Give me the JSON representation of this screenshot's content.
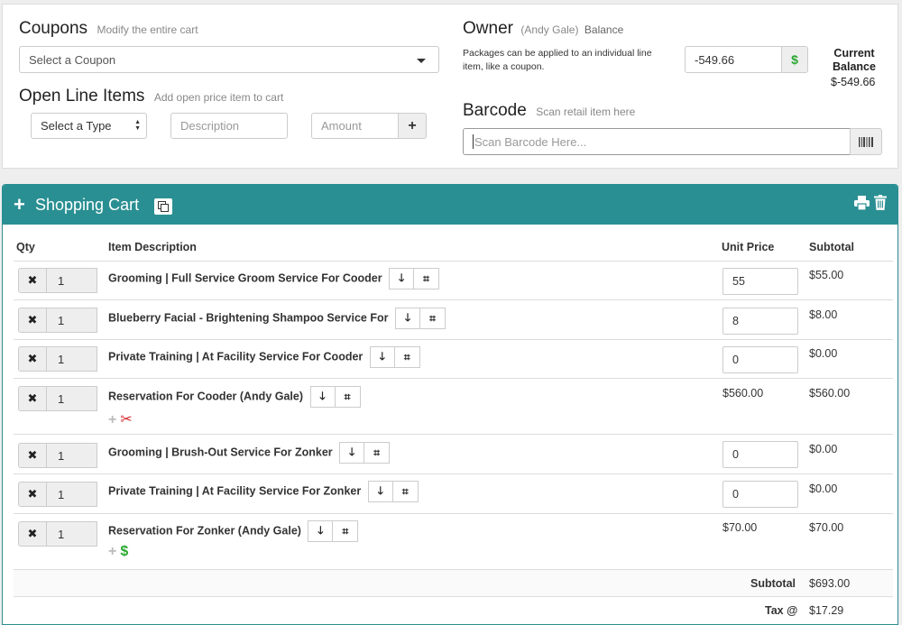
{
  "coupons": {
    "title": "Coupons",
    "subtitle": "Modify the entire cart",
    "select_value": "Select a Coupon"
  },
  "open_items": {
    "title": "Open Line Items",
    "subtitle": "Add open price item to cart",
    "type_value": "Select a Type",
    "description_placeholder": "Description",
    "amount_placeholder": "Amount",
    "add_label": "+"
  },
  "owner": {
    "title": "Owner",
    "owner_name": "(Andy Gale)",
    "balance_label": "Balance",
    "note": "Packages can be applied to an individual line item, like a coupon.",
    "balance_value": "-549.66",
    "dollar_label": "$",
    "current_balance_label": "Current Balance",
    "current_balance_value": "$-549.66"
  },
  "barcode": {
    "title": "Barcode",
    "subtitle": "Scan retail item here",
    "placeholder": "Scan Barcode Here..."
  },
  "cart": {
    "title": "Shopping Cart",
    "columns": {
      "qty": "Qty",
      "description": "Item Description",
      "unit_price": "Unit Price",
      "subtotal": "Subtotal"
    },
    "rows": [
      {
        "qty": "1",
        "description": "Grooming | Full Service Groom Service For Cooder",
        "unit_price": "55",
        "subtotal": "$55.00"
      },
      {
        "qty": "1",
        "description": "Blueberry Facial - Brightening Shampoo Service For",
        "unit_price": "8",
        "subtotal": "$8.00"
      },
      {
        "qty": "1",
        "description": "Private Training | At Facility Service For Cooder",
        "unit_price": "0",
        "subtotal": "$0.00"
      },
      {
        "qty": "1",
        "description": "Reservation For Cooder (Andy Gale)",
        "unit_price": "$560.00",
        "subtotal": "$560.00"
      },
      {
        "qty": "1",
        "description": "Grooming | Brush-Out Service For Zonker",
        "unit_price": "0",
        "subtotal": "$0.00"
      },
      {
        "qty": "1",
        "description": "Private Training | At Facility Service For Zonker",
        "unit_price": "0",
        "subtotal": "$0.00"
      },
      {
        "qty": "1",
        "description": "Reservation For Zonker (Andy Gale)",
        "unit_price": "$70.00",
        "subtotal": "$70.00"
      }
    ],
    "totals": {
      "subtotal_label": "Subtotal",
      "subtotal_value": "$693.00",
      "tax_label": "Tax @",
      "tax_value": "$17.29"
    },
    "icons": {
      "remove": "✖",
      "move_down": "🡓",
      "discount": "tag-icon",
      "add": "+",
      "scissors": "✂",
      "dollar": "$"
    }
  },
  "colors": {
    "accent": "#2a8f92",
    "green": "#2aa830",
    "red": "#d9262b"
  }
}
